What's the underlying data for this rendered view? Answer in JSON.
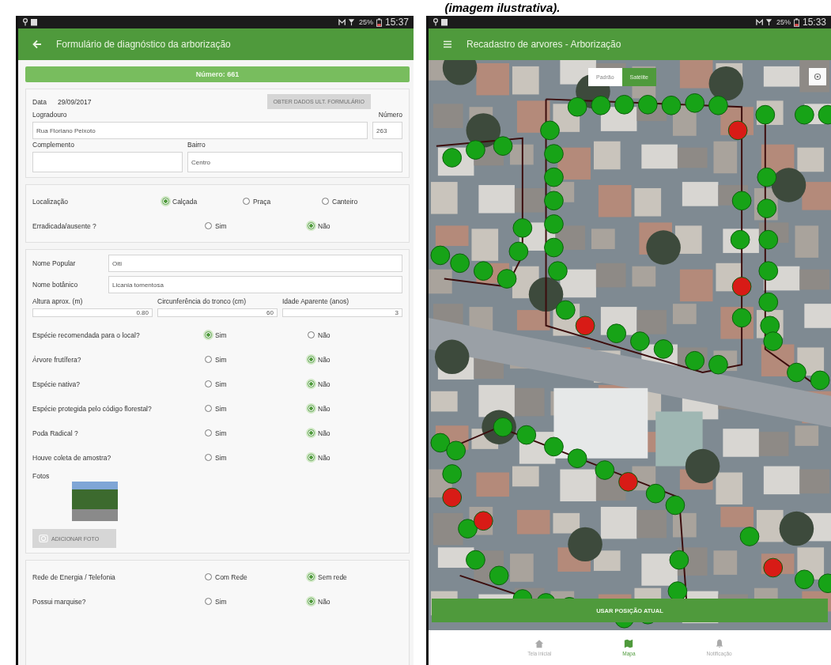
{
  "caption": "(imagem ilustrativa).",
  "form_screen": {
    "status_bar": {
      "battery": "25%",
      "time": "15:37"
    },
    "app_bar": {
      "title": "Formulário de diagnóstico da arborização"
    },
    "number_banner": "Número: 661",
    "date": {
      "label": "Data",
      "value": "29/09/2017"
    },
    "load_button": {
      "label": "OBTER DADOS ULT. FORMULÁRIO",
      "disabled": true
    },
    "address_fields": [
      {
        "label": "Logradouro",
        "value": "Rua Floriano Peixoto"
      },
      {
        "label": "Número",
        "value": "263"
      }
    ],
    "extra_fields": [
      {
        "label": "Complemento"
      },
      {
        "label": "Bairro",
        "value": "Centro"
      }
    ],
    "location_questions": [
      {
        "label": "Localização",
        "options": [
          {
            "label": "Calçada",
            "selected": true
          },
          {
            "label": "Praça",
            "selected": false
          },
          {
            "label": "Canteiro",
            "selected": false
          }
        ]
      },
      {
        "label": "Erradicada/ausente ?",
        "options": [
          {
            "label": "Sim",
            "selected": false
          },
          {
            "label": "Não",
            "selected": true
          }
        ]
      }
    ],
    "name_fields": [
      {
        "label": "Nome Popular",
        "value": "Oiti"
      },
      {
        "label": "Nome botânico",
        "value": "Licania tomentosa"
      }
    ],
    "measure_fields": [
      {
        "label": "Altura aprox. (m)",
        "value": "0.80"
      },
      {
        "label": "Circunferência do tronco (cm)",
        "value": "60"
      },
      {
        "label": "Idade Aparente (anos)",
        "value": "3"
      }
    ],
    "tree_questions": [
      {
        "label": "Espécie recomendada para o local?",
        "options": [
          {
            "label": "Sim",
            "selected": true
          },
          {
            "label": "Não",
            "selected": false
          }
        ]
      },
      {
        "label": "Árvore frutífera?",
        "options": [
          {
            "label": "Sim",
            "selected": false
          },
          {
            "label": "Não",
            "selected": true
          }
        ]
      },
      {
        "label": "Espécie nativa?",
        "options": [
          {
            "label": "Sim",
            "selected": false
          },
          {
            "label": "Não",
            "selected": true
          }
        ]
      },
      {
        "label": "Espécie protegida pelo código florestal?",
        "options": [
          {
            "label": "Sim",
            "selected": false
          },
          {
            "label": "Não",
            "selected": true
          }
        ]
      },
      {
        "label": "Poda Radical ?",
        "options": [
          {
            "label": "Sim",
            "selected": false
          },
          {
            "label": "Não",
            "selected": true
          }
        ]
      },
      {
        "label": "Houve coleta de amostra?",
        "options": [
          {
            "label": "Sim",
            "selected": false
          },
          {
            "label": "Não",
            "selected": true
          }
        ]
      }
    ],
    "photos_label": "Fotos",
    "add_photo_button": {
      "label": "ADICIONAR FOTO",
      "disabled": true
    },
    "network_questions": [
      {
        "label": "Rede de Energia / Telefonia",
        "options": [
          {
            "label": "Com Rede",
            "selected": false
          },
          {
            "label": "Sem rede",
            "selected": true
          }
        ]
      },
      {
        "label": "Possui marquise?",
        "options": [
          {
            "label": "Sim",
            "selected": false
          },
          {
            "label": "Não",
            "selected": true
          }
        ]
      }
    ]
  },
  "map_screen": {
    "status_bar": {
      "battery": "25%",
      "time": "15:33"
    },
    "app_bar": {
      "title": "Recadastro de arvores - Arborização"
    },
    "map_type_toggle": [
      {
        "label": "Padrão",
        "selected": false
      },
      {
        "label": "Satélite",
        "selected": true
      }
    ],
    "action_button": "USAR POSIÇÃO ATUAL",
    "bottom_nav": [
      {
        "label": "Tela inicial",
        "selected": false
      },
      {
        "label": "Mapa",
        "selected": true
      },
      {
        "label": "Notificação",
        "selected": false
      }
    ]
  }
}
